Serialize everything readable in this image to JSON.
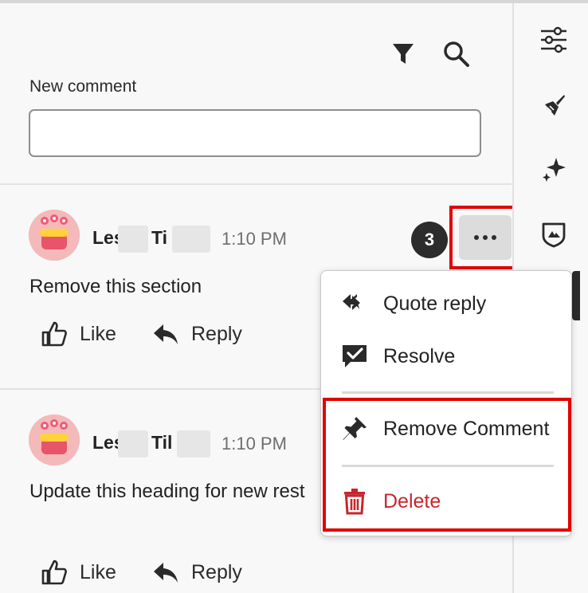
{
  "toolbar": {
    "filter_icon": "filter-icon",
    "search_icon": "search-icon"
  },
  "new_comment": {
    "label": "New comment",
    "value": "",
    "placeholder": ""
  },
  "comments": [
    {
      "author_first": "Les",
      "author_last": "Ti",
      "time": "1:10 PM",
      "text": "Remove this section",
      "reply_count": "3",
      "like_label": "Like",
      "reply_label": "Reply"
    },
    {
      "author_first": "Les",
      "author_last": "Til",
      "time": "1:10 PM",
      "text": "Update this heading for new rest",
      "like_label": "Like",
      "reply_label": "Reply"
    }
  ],
  "menu": {
    "items": [
      {
        "label": "Quote reply",
        "icon": "quote-reply-icon"
      },
      {
        "label": "Resolve",
        "icon": "resolve-icon"
      },
      {
        "label": "Remove Comment",
        "icon": "pin-icon"
      },
      {
        "label": "Delete",
        "icon": "trash-icon"
      }
    ]
  },
  "rail": {
    "icons": [
      "sliders-icon",
      "brush-icon",
      "sparkle-icon",
      "shield-icon"
    ]
  },
  "colors": {
    "highlight_red": "#e00000",
    "delete_red": "#c9252c",
    "badge_bg": "#2c2c2c",
    "accent_dark": "#222222"
  }
}
